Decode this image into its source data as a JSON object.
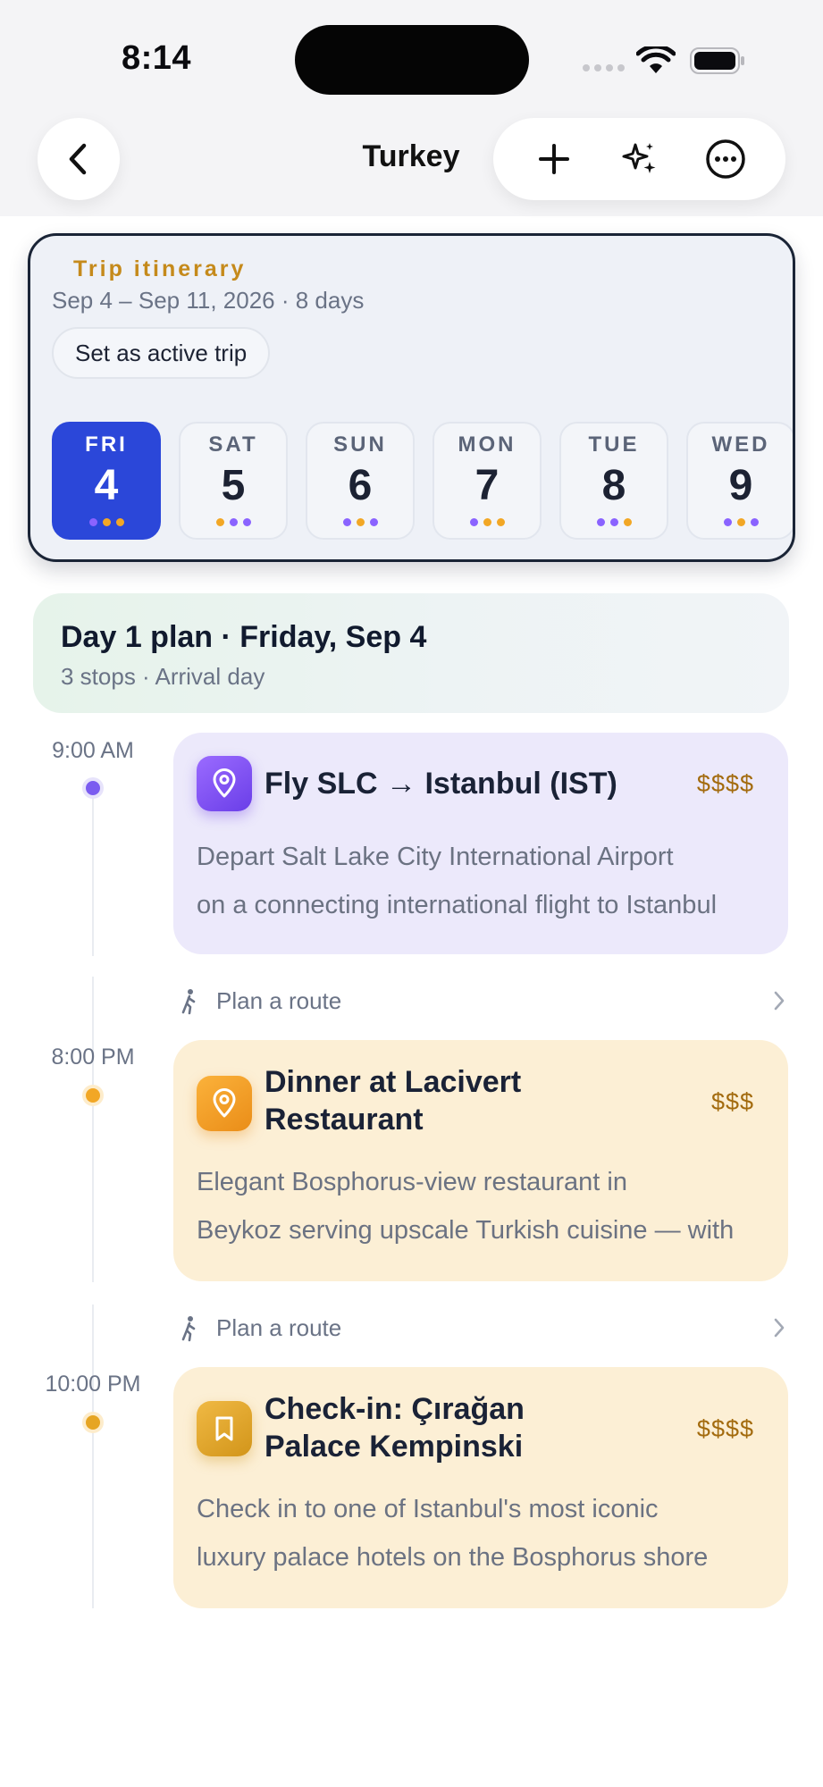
{
  "status_bar": {
    "time": "8:14"
  },
  "nav": {
    "title": "Turkey"
  },
  "trip": {
    "label": "Trip itinerary",
    "dates": "Sep 4 – Sep 11, 2026 · 8 days",
    "active_button": "Set as active trip",
    "days": [
      {
        "dow": "FRI",
        "num": "4",
        "selected": true,
        "dots": [
          "#8a63ff",
          "#f2a725",
          "#f2a725"
        ]
      },
      {
        "dow": "SAT",
        "num": "5",
        "selected": false,
        "dots": [
          "#f2a725",
          "#8a63ff",
          "#8a63ff"
        ]
      },
      {
        "dow": "SUN",
        "num": "6",
        "selected": false,
        "dots": [
          "#8a63ff",
          "#f2a725",
          "#8a63ff"
        ]
      },
      {
        "dow": "MON",
        "num": "7",
        "selected": false,
        "dots": [
          "#8a63ff",
          "#f2a725",
          "#f2a725"
        ]
      },
      {
        "dow": "TUE",
        "num": "8",
        "selected": false,
        "dots": [
          "#8a63ff",
          "#8a63ff",
          "#f2a725"
        ]
      },
      {
        "dow": "WED",
        "num": "9",
        "selected": false,
        "dots": [
          "#8a63ff",
          "#f2a725",
          "#8a63ff"
        ]
      }
    ]
  },
  "plan": {
    "title": "Day 1 plan · Friday, Sep 4",
    "subtitle": "3 stops · Arrival day"
  },
  "stops": [
    {
      "time": "9:00 AM",
      "title": "Fly SLC → Istanbul (IST)",
      "price": "$$$$",
      "desc_line1": "Depart Salt Lake City International Airport",
      "desc_line2": "on a connecting international flight to Istanbul",
      "icon": "map-pin-icon",
      "theme": "#ece9fb",
      "accent": "#7b4cf0"
    },
    {
      "time": "8:00 PM",
      "title_line1": "Dinner at Lacivert",
      "title_line2": "Restaurant",
      "price": "$$$",
      "desc_line1": "Elegant Bosphorus-view restaurant in",
      "desc_line2": "Beykoz serving upscale Turkish cuisine — with",
      "icon": "map-pin-icon",
      "theme": "#fcefd5",
      "accent": "#f0a224"
    },
    {
      "time": "10:00 PM",
      "title_line1": "Check-in: Çırağan",
      "title_line2": "Palace Kempinski",
      "price": "$$$$",
      "desc_line1": "Check in to one of Istanbul's most iconic",
      "desc_line2": "luxury palace hotels on the Bosphorus shore",
      "icon": "bookmark-icon",
      "theme": "#fcefd5",
      "accent": "#e6a523"
    }
  ],
  "routes": [
    {
      "label": "Plan a route"
    },
    {
      "label": "Plan a route"
    }
  ]
}
